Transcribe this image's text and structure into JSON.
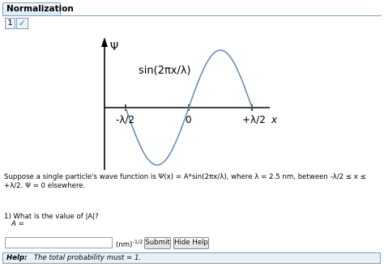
{
  "tab": {
    "title": "Normalization"
  },
  "part": {
    "number": "1",
    "status_icon": "checkmark-icon"
  },
  "figure": {
    "ylabel": "Ψ",
    "xlabel": "x",
    "func_label": "sin(2πx/λ)",
    "tick_left": "-λ/2",
    "tick_zero": "0",
    "tick_right": "+λ/2",
    "curve_color": "#6a8db5"
  },
  "problem": {
    "text": "Suppose a single particle's wave function is Ψ(x) = A*sin(2πx/λ), where λ = 2.5 nm, between -λ/2 ≤ x ≤ +λ/2. Ψ = 0 elsewhere."
  },
  "question": {
    "prompt": "1) What is the value of |A|?",
    "variable": "A ="
  },
  "answer": {
    "value": "",
    "units": "(nm)",
    "units_exp": "-1/2"
  },
  "buttons": {
    "submit": "Submit",
    "hide_help": "Hide Help"
  },
  "help": {
    "label": "Help:",
    "text": "The total probability must = 1."
  }
}
